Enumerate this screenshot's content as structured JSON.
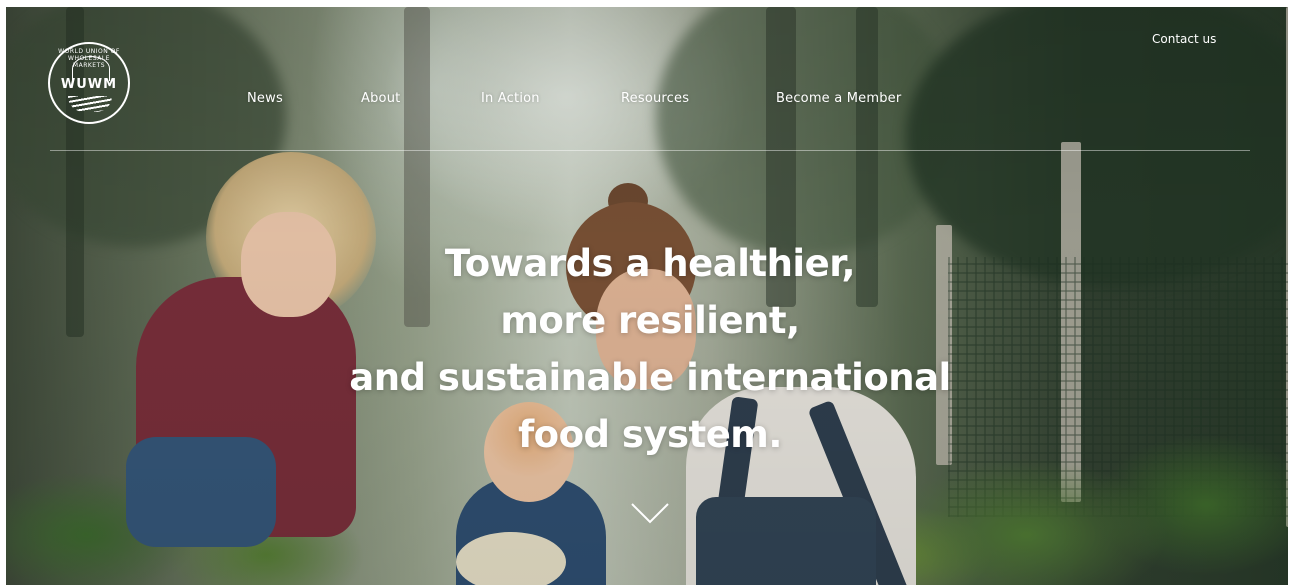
{
  "brand": {
    "logo_text": "WUWM",
    "logo_ring_text": "WORLD UNION OF WHOLESALE MARKETS"
  },
  "nav": {
    "items": [
      {
        "label": "News"
      },
      {
        "label": "About"
      },
      {
        "label": "In Action"
      },
      {
        "label": "Resources"
      },
      {
        "label": "Become a Member"
      }
    ],
    "contact_label": "Contact us"
  },
  "hero": {
    "headline_lines": [
      "Towards a healthier,",
      "more resilient,",
      "and sustainable international",
      "food system."
    ],
    "scroll_icon": "chevron-down-icon"
  },
  "colors": {
    "text": "#ffffff"
  }
}
